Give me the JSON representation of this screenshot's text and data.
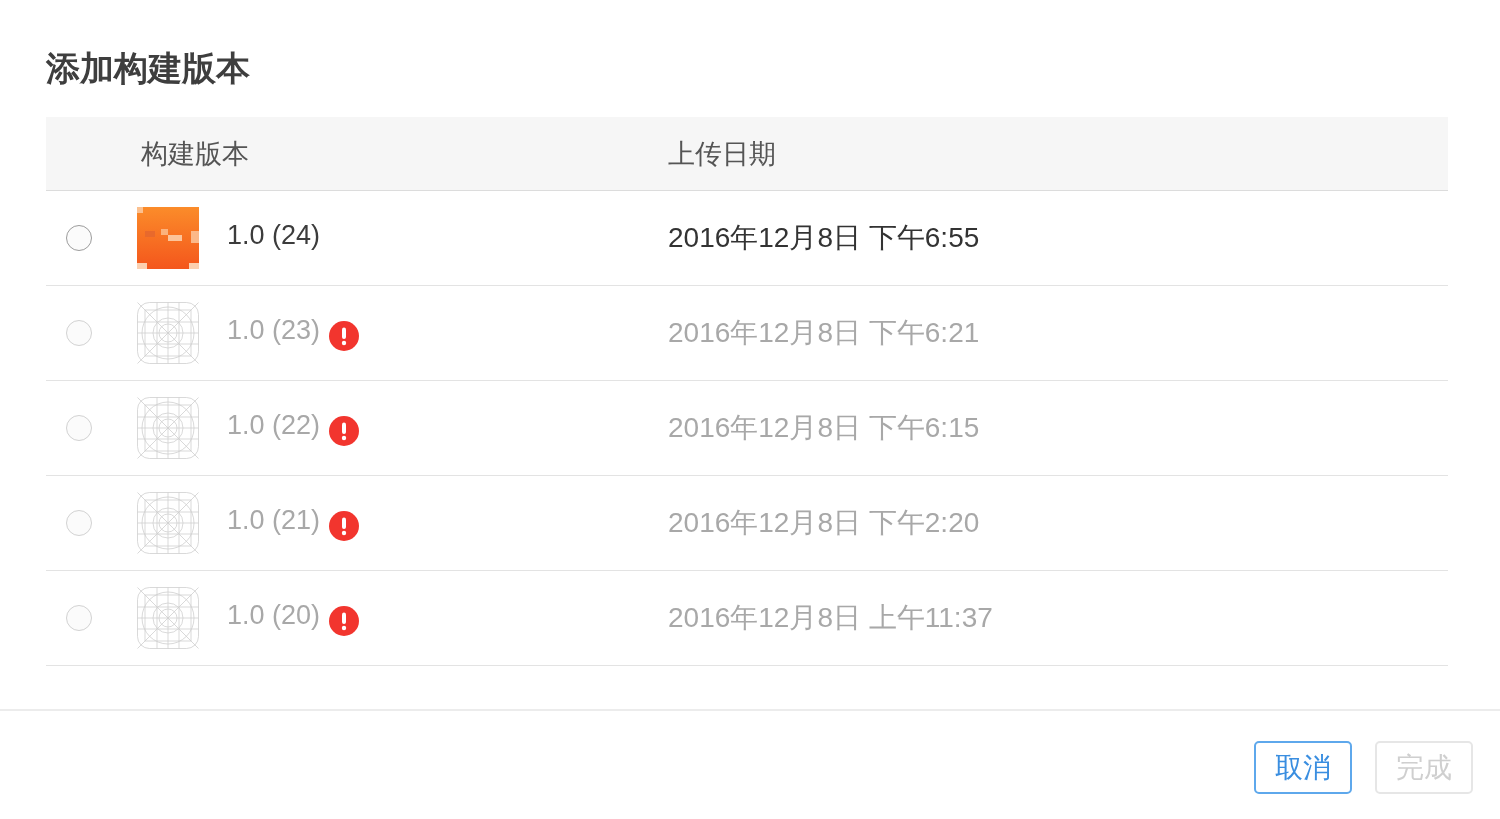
{
  "title": "添加构建版本",
  "table": {
    "columns": [
      "构建版本",
      "上传日期"
    ],
    "rows": [
      {
        "selected": false,
        "kind": "app",
        "version": "1.0 (24)",
        "warning": false,
        "disabled": false,
        "upload_date": "2016年12月8日 下午6:55"
      },
      {
        "selected": false,
        "kind": "placeholder",
        "version": "1.0 (23)",
        "warning": true,
        "disabled": true,
        "upload_date": "2016年12月8日 下午6:21"
      },
      {
        "selected": false,
        "kind": "placeholder",
        "version": "1.0 (22)",
        "warning": true,
        "disabled": true,
        "upload_date": "2016年12月8日 下午6:15"
      },
      {
        "selected": false,
        "kind": "placeholder",
        "version": "1.0 (21)",
        "warning": true,
        "disabled": true,
        "upload_date": "2016年12月8日 下午2:20"
      },
      {
        "selected": false,
        "kind": "placeholder",
        "version": "1.0 (20)",
        "warning": true,
        "disabled": true,
        "upload_date": "2016年12月8日 上午11:37"
      }
    ]
  },
  "buttons": [
    {
      "label": "取消",
      "disabled": false
    },
    {
      "label": "完成",
      "disabled": true
    }
  ]
}
